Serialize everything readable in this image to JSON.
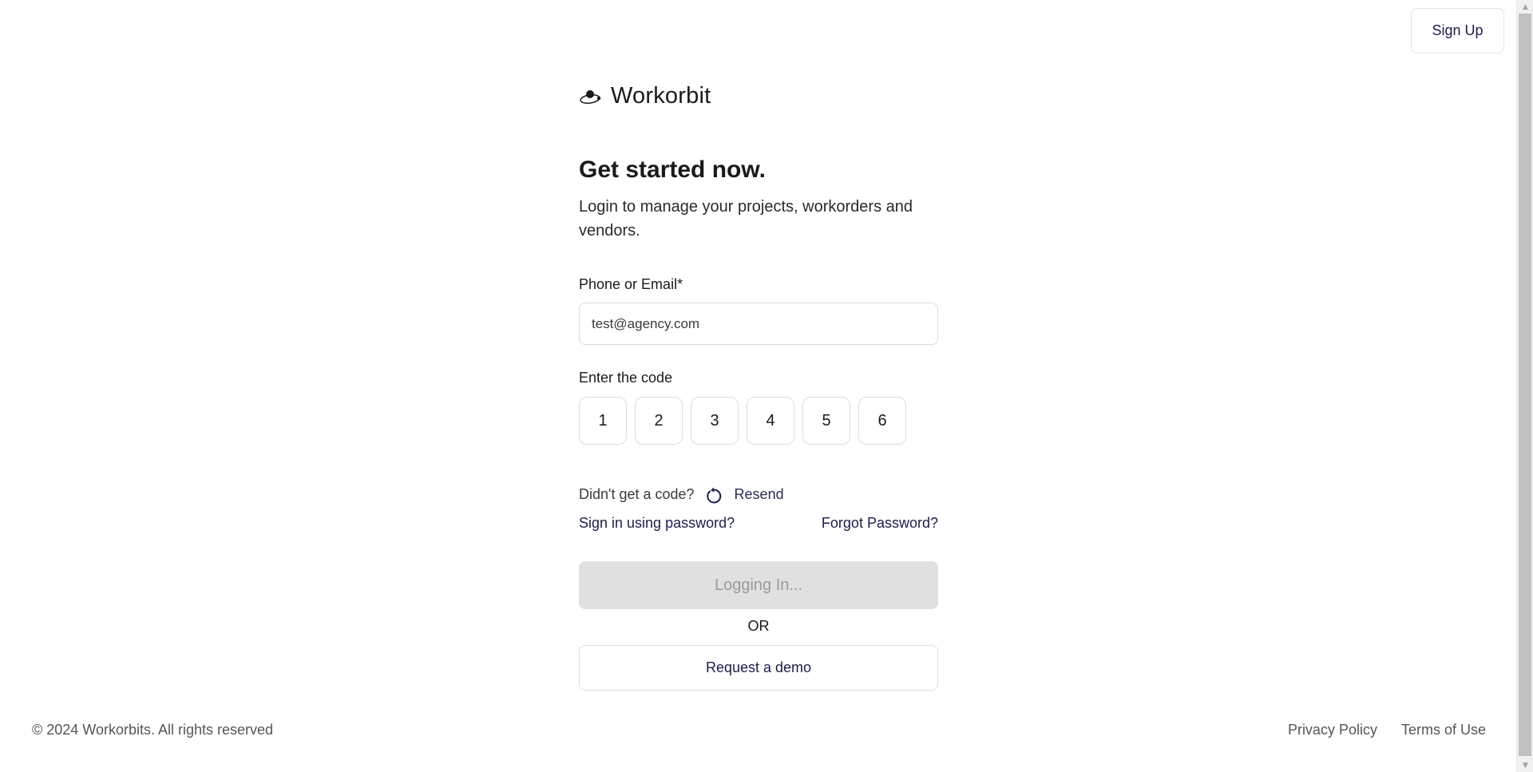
{
  "header": {
    "signup_label": "Sign Up"
  },
  "brand": {
    "name": "Workorbit",
    "icon": "orbit-logo-icon"
  },
  "intro": {
    "heading": "Get started now.",
    "subtitle": "Login to manage your projects, workorders and vendors."
  },
  "form": {
    "email_label": "Phone or Email*",
    "email_value": "test@agency.com",
    "code_label": "Enter the code",
    "code_digits": [
      "1",
      "2",
      "3",
      "4",
      "5",
      "6"
    ],
    "didnt_get_code": "Didn't get a code?",
    "resend_icon": "refresh-icon",
    "resend_label": "Resend",
    "password_signin_link": "Sign in using password?",
    "forgot_password_link": "Forgot Password?",
    "login_button": "Logging In...",
    "or_label": "OR",
    "demo_button": "Request a demo"
  },
  "footer": {
    "copyright": "© 2024 Workorbits. All rights reserved",
    "privacy": "Privacy Policy",
    "terms": "Terms of Use"
  },
  "colors": {
    "link": "#1b1d4a",
    "disabled_button_bg": "#e0e0e0",
    "disabled_button_text": "#9a9a9a"
  }
}
